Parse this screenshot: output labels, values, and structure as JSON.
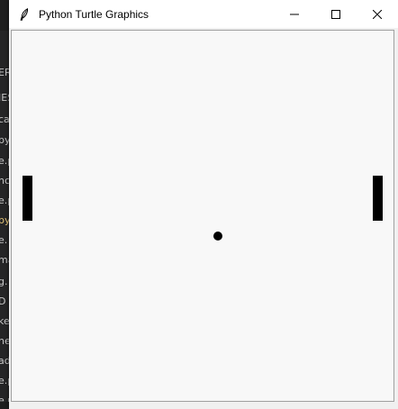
{
  "window": {
    "title": "Python Turtle Graphics",
    "icon": "feather-icon"
  },
  "controls": {
    "minimize": "minimize-icon",
    "maximize": "maximize-icon",
    "close": "close-icon"
  },
  "game": {
    "background_color": "#f8f8f8",
    "paddle_color": "#000000",
    "ball_color": "#000000"
  },
  "bg_sidebar": {
    "items": [
      "ER",
      "IES",
      "ca",
      "py",
      "e.p",
      "ncl",
      "e.p",
      "py",
      "e.",
      "ma",
      "g.",
      "D",
      "ke",
      "ne",
      "ad",
      "e.p",
      "e.p"
    ]
  }
}
